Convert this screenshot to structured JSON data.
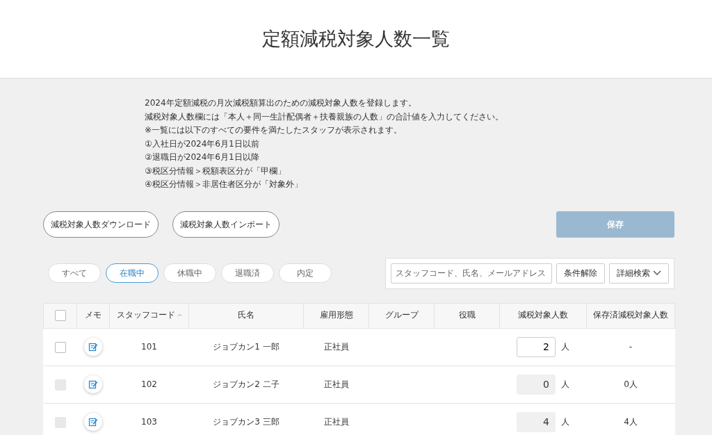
{
  "page_title": "定額減税対象人数一覧",
  "notes": [
    "2024年定額減税の月次減税額算出のための減税対象人数を登録します。",
    "減税対象人数欄には「本人＋同一生計配偶者＋扶養親族の人数」の合計値を入力してください。",
    "※一覧には以下のすべての要件を満たしたスタッフが表示されます。",
    "①入社日が2024年6月1日以前",
    "②退職日が2024年6月1日以降",
    "③税区分情報＞税額表区分が「甲欄」",
    "④税区分情報＞非居住者区分が「対象外」"
  ],
  "actions": [
    "減税対象人数ダウンロード",
    "減税対象人数インポート"
  ],
  "save_button": {
    "label": "保存",
    "disabled": true
  },
  "status_filters": [
    {
      "label": "すべて",
      "selected": false
    },
    {
      "label": "在職中",
      "selected": true
    },
    {
      "label": "休職中",
      "selected": false
    },
    {
      "label": "退職済",
      "selected": false
    },
    {
      "label": "内定",
      "selected": false
    }
  ],
  "search": {
    "placeholder": "スタッフコード、氏名、メールアドレス",
    "clear_button": "条件解除",
    "advanced_button": "詳細検索"
  },
  "table": {
    "select_all_checked": false,
    "columns": [
      {
        "label": "メモ",
        "sorted": false
      },
      {
        "label": "スタッフコード",
        "sorted": true
      },
      {
        "label": "氏名",
        "sorted": false
      },
      {
        "label": "雇用形態",
        "sorted": false
      },
      {
        "label": "グループ",
        "sorted": false
      },
      {
        "label": "役職",
        "sorted": false
      },
      {
        "label": "減税対象人数",
        "sorted": false
      },
      {
        "label": "保存済減税対象人数",
        "sorted": false
      }
    ],
    "rows": [
      {
        "checked": false,
        "disabled": false,
        "code": "101",
        "name": "ジョブカン1 一郎",
        "employment": "正社員",
        "count": "2",
        "unit": "人",
        "saved": "-"
      },
      {
        "checked": false,
        "disabled": true,
        "code": "102",
        "name": "ジョブカン2 二子",
        "employment": "正社員",
        "count": "0",
        "unit": "人",
        "saved": "0人"
      },
      {
        "checked": false,
        "disabled": true,
        "code": "103",
        "name": "ジョブカン3 三郎",
        "employment": "正社員",
        "count": "4",
        "unit": "人",
        "saved": "4人"
      }
    ]
  }
}
